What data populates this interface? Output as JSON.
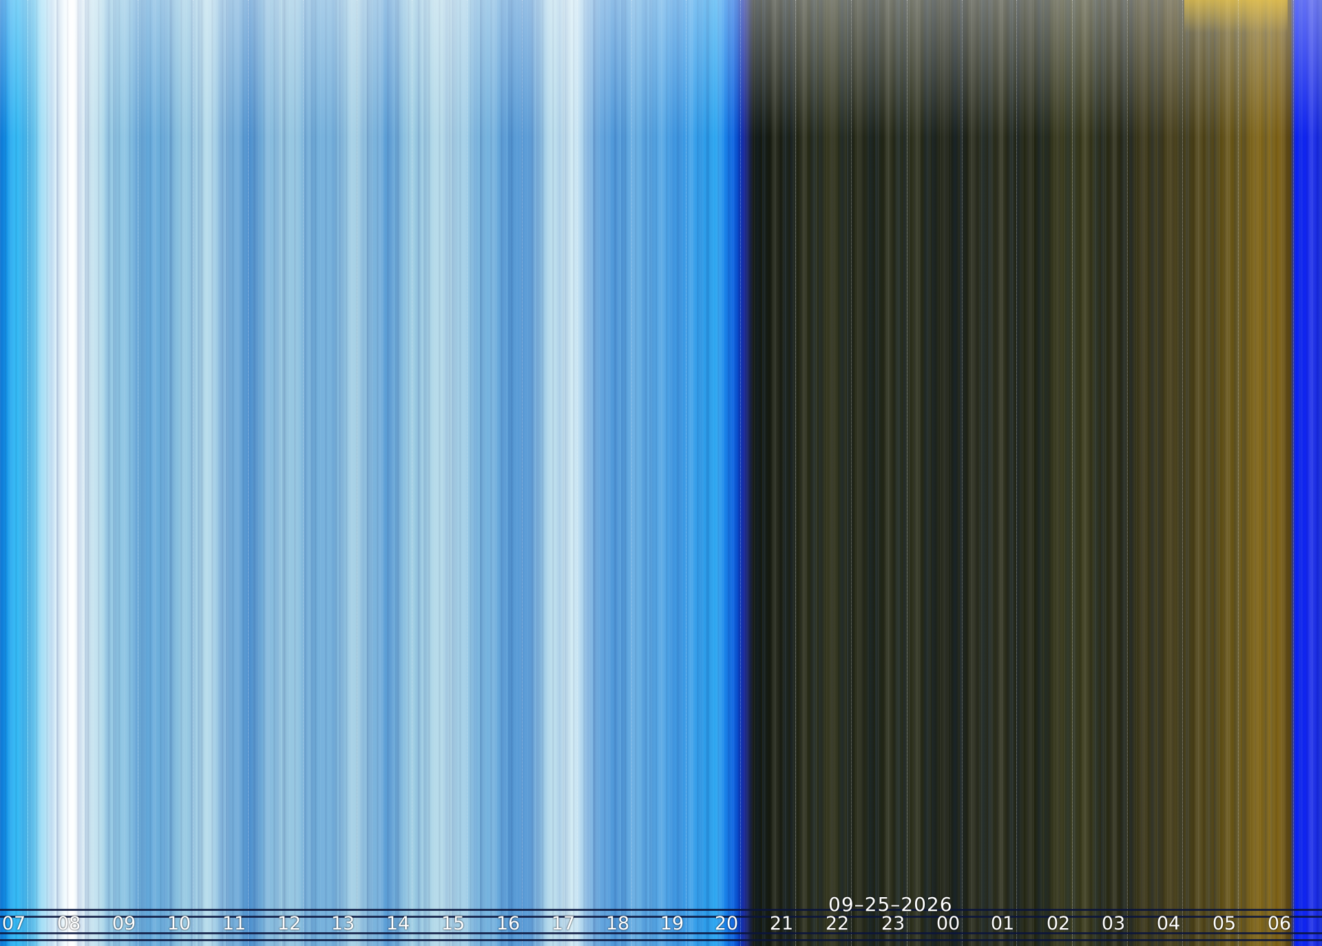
{
  "date": "09–25–2026",
  "hours": [
    "07",
    "08",
    "09",
    "10",
    "11",
    "12",
    "13",
    "14",
    "15",
    "16",
    "17",
    "18",
    "19",
    "20",
    "21",
    "22",
    "23",
    "00",
    "01",
    "02",
    "03",
    "04",
    "05",
    "06"
  ]
}
